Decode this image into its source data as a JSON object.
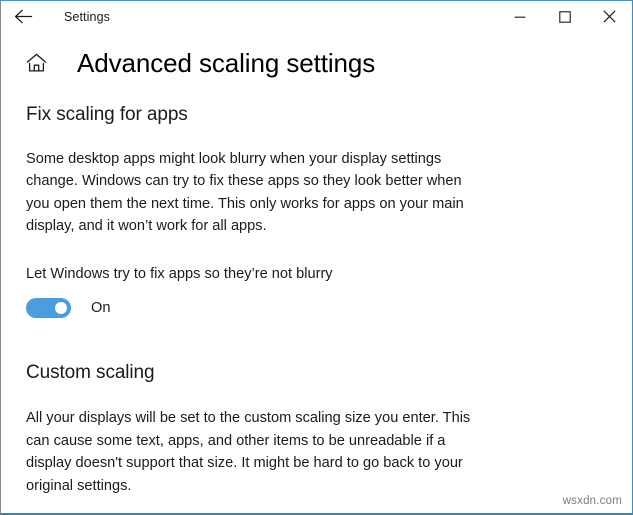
{
  "window": {
    "titlebar": {
      "back_label": "Back",
      "app_title": "Settings",
      "minimize_label": "Minimize",
      "maximize_label": "Maximize",
      "close_label": "Close"
    },
    "accent_color": "#2f86bf",
    "toggle_on_color": "#4a9ee0"
  },
  "header": {
    "home_label": "Home",
    "page_title": "Advanced scaling settings"
  },
  "sections": {
    "fix_scaling": {
      "heading": "Fix scaling for apps",
      "description": "Some desktop apps might look blurry when your display settings change. Windows can try to fix these apps so they look better when you open them the next time. This only works for apps on your main display, and it won’t work for all apps.",
      "toggle": {
        "label": "Let Windows try to fix apps so they’re not blurry",
        "state": "On",
        "checked": true
      }
    },
    "custom_scaling": {
      "heading": "Custom scaling",
      "description": "All your displays will be set to the custom scaling size you enter. This can cause some text, apps, and other items to be unreadable if a display doesn't support that size. It might be hard to go back to your original settings."
    }
  },
  "watermark": "wsxdn.com"
}
